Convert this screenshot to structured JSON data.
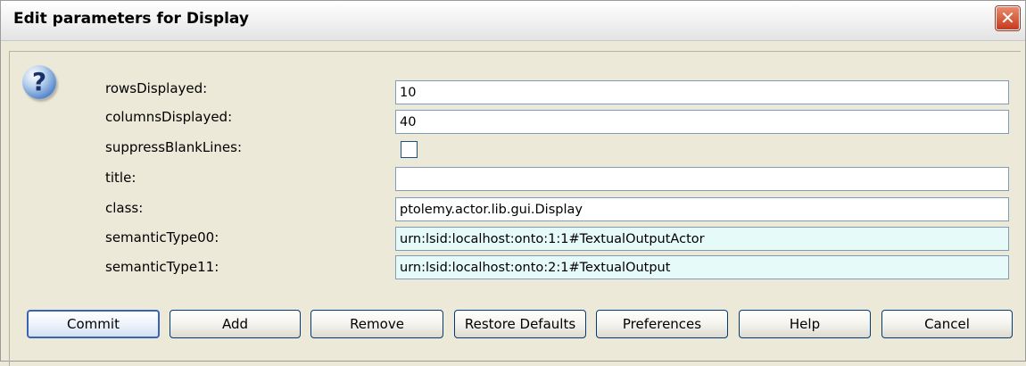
{
  "window": {
    "title": "Edit parameters for Display"
  },
  "icons": {
    "close": "close-icon",
    "question": "question-icon"
  },
  "params": [
    {
      "label": "rowsDisplayed:",
      "value": "10",
      "kind": "text"
    },
    {
      "label": "columnsDisplayed:",
      "value": "40",
      "kind": "text"
    },
    {
      "label": "suppressBlankLines:",
      "value": false,
      "kind": "checkbox"
    },
    {
      "label": "title:",
      "value": "",
      "kind": "text"
    },
    {
      "label": "class:",
      "value": "ptolemy.actor.lib.gui.Display",
      "kind": "text"
    },
    {
      "label": "semanticType00:",
      "value": "urn:lsid:localhost:onto:1:1#TextualOutputActor",
      "kind": "semantic"
    },
    {
      "label": "semanticType11:",
      "value": "urn:lsid:localhost:onto:2:1#TextualOutput",
      "kind": "semantic"
    }
  ],
  "buttons": {
    "commit": "Commit",
    "add": "Add",
    "remove": "Remove",
    "restore": "Restore Defaults",
    "preferences": "Preferences",
    "help": "Help",
    "cancel": "Cancel"
  },
  "colors": {
    "semantic_field_bg": "#e6fafa",
    "dialog_bg": "#ece9d8",
    "close_button": "#c8391c"
  }
}
